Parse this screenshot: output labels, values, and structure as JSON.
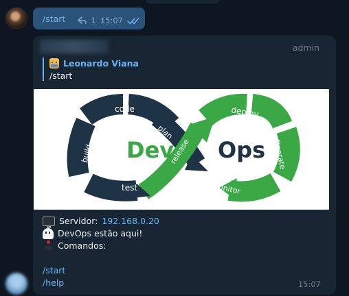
{
  "outgoing": {
    "text": "/start",
    "reply_count": "1",
    "time": "15:07"
  },
  "incoming": {
    "badge": "admin",
    "reply": {
      "author": "Leonardo Viana",
      "text": "/start"
    },
    "banner": {
      "left_word": "Dev",
      "right_word": "Ops",
      "labels": [
        "code",
        "plan",
        "build",
        "test",
        "release",
        "deploy",
        "Operate",
        "monitor"
      ]
    },
    "info": {
      "server_label": "Servidor:",
      "server_ip": "192.168.0.20",
      "line2": "DevOps estão aqui!",
      "line3": "Comandos:"
    },
    "commands": [
      "/start",
      "/help"
    ],
    "time": "15:07"
  },
  "colors": {
    "background": "#0e1621",
    "bubble_out": "#2b5278",
    "bubble_in": "#182533",
    "link": "#71b5f2",
    "devops_dark": "#1f3347",
    "devops_green": "#39a845"
  },
  "icons": [
    "reply-icon",
    "double-check-icon",
    "person-emoji-icon",
    "monitor-icon",
    "ghost-icon",
    "joystick-icon"
  ]
}
